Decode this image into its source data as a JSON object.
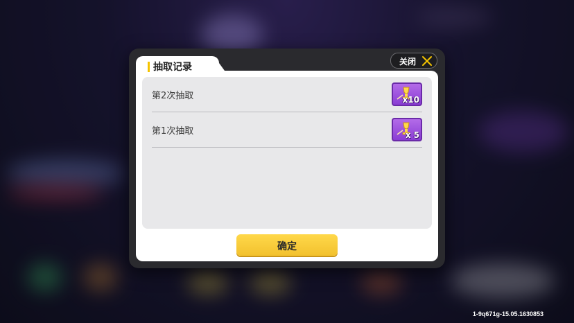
{
  "dialog": {
    "title": "抽取记录",
    "close_label": "关闭",
    "confirm_label": "确定",
    "records": [
      {
        "label": "第2次抽取",
        "reward_count": "x10",
        "reward_icon": "golden-trophy-icon"
      },
      {
        "label": "第1次抽取",
        "reward_count": "x 5",
        "reward_icon": "golden-trophy-icon"
      }
    ]
  },
  "build_id": "1-9q671g-15.05.1630853",
  "colors": {
    "accent": "#f5c400",
    "confirm_button": "#f2c12e",
    "reward_bg": "#9b50df",
    "dialog_frame": "#2a2a2e"
  }
}
